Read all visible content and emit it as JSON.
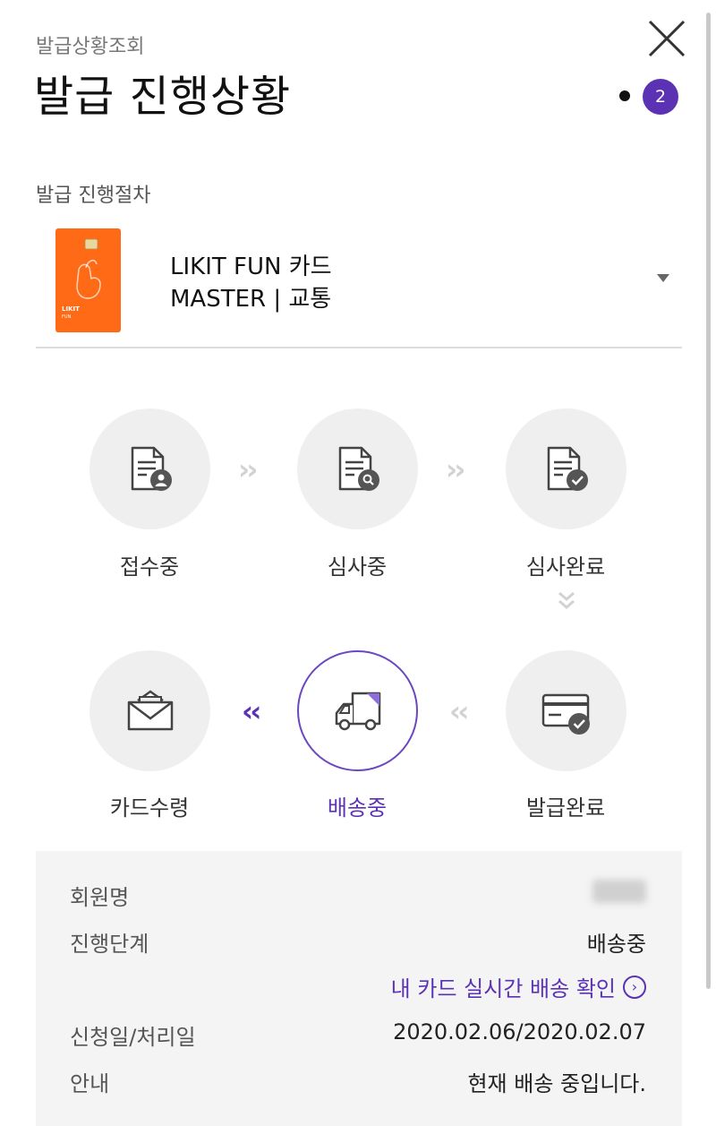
{
  "header": {
    "breadcrumb": "발급상황조회",
    "title": "발급 진행상황",
    "badge_count": "2"
  },
  "section_label": "발급 진행절차",
  "card": {
    "name_line1": "LIKIT FUN 카드",
    "name_line2": "MASTER | 교통",
    "thumb_brand": "LIKIT",
    "thumb_sub": "FUN",
    "thumb_color": "#ff6a16"
  },
  "steps": [
    {
      "label": "접수중",
      "icon": "document-user-icon",
      "active": false
    },
    {
      "label": "심사중",
      "icon": "document-search-icon",
      "active": false
    },
    {
      "label": "심사완료",
      "icon": "document-check-icon",
      "active": false
    },
    {
      "label": "발급완료",
      "icon": "card-check-icon",
      "active": false
    },
    {
      "label": "배송중",
      "icon": "delivery-truck-icon",
      "active": true
    },
    {
      "label": "카드수령",
      "icon": "envelope-icon",
      "active": false
    }
  ],
  "info": {
    "member_label": "회원명",
    "stage_label": "진행단계",
    "stage_value": "배송중",
    "tracking_link": "내 카드 실시간 배송 확인",
    "date_label": "신청일/처리일",
    "date_value": "2020.02.06/2020.02.07",
    "notice_label": "안내",
    "notice_value": "현재 배송 중입니다."
  },
  "colors": {
    "accent": "#5b32b4",
    "step_bg": "#efefef",
    "info_bg": "#f4f4f4"
  }
}
